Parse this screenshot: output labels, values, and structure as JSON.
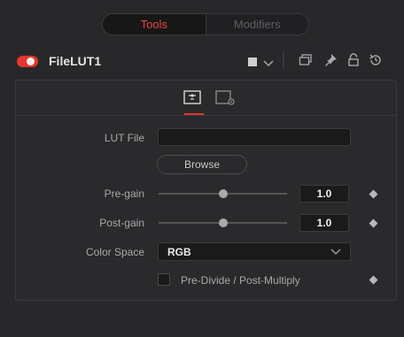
{
  "tabs": {
    "tools": "Tools",
    "modifiers": "Modifiers"
  },
  "header": {
    "tool_name": "FileLUT1"
  },
  "colors": {
    "accent": "#e2372c",
    "tab_active_text": "#e8473a"
  },
  "icons": {
    "color_swatch": "color-swatch-icon",
    "dropdown": "chevron-down-icon",
    "version": "versions-icon",
    "pin": "pin-icon",
    "lock": "lock-icon",
    "reset": "reset-icon",
    "controls_tab": "controls-tab-icon",
    "settings_tab": "settings-tab-icon"
  },
  "controls": {
    "lut_file": {
      "label": "LUT File",
      "value": ""
    },
    "browse": {
      "label": "Browse"
    },
    "pre_gain": {
      "label": "Pre-gain",
      "value": "1.0",
      "slider_fraction": 0.5
    },
    "post_gain": {
      "label": "Post-gain",
      "value": "1.0",
      "slider_fraction": 0.5
    },
    "color_space": {
      "label": "Color Space",
      "selected": "RGB"
    },
    "predivide": {
      "label": "Pre-Divide / Post-Multiply",
      "checked": false
    }
  }
}
